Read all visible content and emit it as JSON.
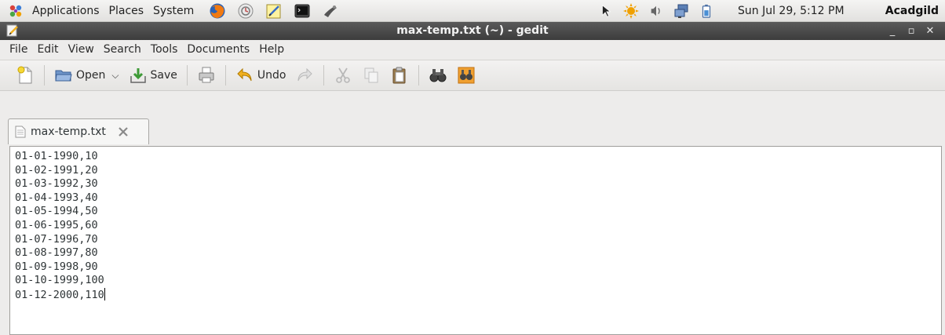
{
  "panel": {
    "menus": [
      "Applications",
      "Places",
      "System"
    ],
    "clock": "Sun Jul 29,  5:12 PM",
    "user": "Acadgild"
  },
  "window": {
    "title": "max-temp.txt (~) - gedit",
    "buttons": [
      "_",
      "▫",
      "✕"
    ]
  },
  "menubar": [
    "File",
    "Edit",
    "View",
    "Search",
    "Tools",
    "Documents",
    "Help"
  ],
  "toolbar": {
    "open_label": "Open",
    "save_label": "Save",
    "undo_label": "Undo"
  },
  "tab": {
    "label": "max-temp.txt"
  },
  "document": {
    "lines": [
      "01-01-1990,10",
      "01-02-1991,20",
      "01-03-1992,30",
      "01-04-1993,40",
      "01-05-1994,50",
      "01-06-1995,60",
      "01-07-1996,70",
      "01-08-1997,80",
      "01-09-1998,90",
      "01-10-1999,100",
      "01-12-2000,110"
    ]
  },
  "colors": {
    "titlebar": "#464646",
    "panel": "#ebeae8",
    "accent_orange": "#f0a000"
  }
}
